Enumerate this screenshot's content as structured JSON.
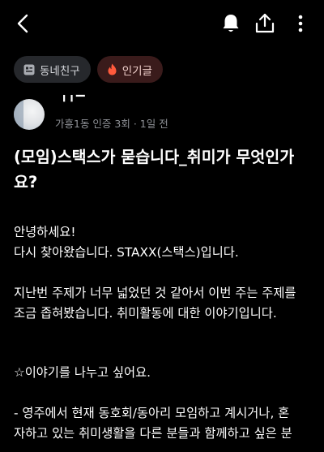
{
  "header": {
    "back_icon": "chevron-left-icon",
    "bell_icon": "bell-icon",
    "share_icon": "share-icon",
    "more_icon": "more-vertical-icon"
  },
  "chips": [
    {
      "label": "동네친구",
      "icon": "community-icon"
    },
    {
      "label": "인기글",
      "icon": "fire-icon",
      "accent": "#ff5a3c"
    }
  ],
  "author": {
    "name": "╹╹▔",
    "meta": "가흥1동 인증 3회 · 1일 전"
  },
  "post": {
    "title": "(모임)스택스가 묻습니다_취미가 무엇인가요?",
    "body": [
      "안녕하세요!",
      "다시 찾아왔습니다. STAXX(스택스)입니다.",
      "지난번 주제가 너무 넓었던 것 같아서 이번 주는 주제를",
      "조금 좁혀봤습니다. 취미활동에 대한 이야기입니다.",
      "☆이야기를 나누고 싶어요.",
      "- 영주에서 현재 동호회/동아리 모임하고 계시거나, 혼",
      "자하고 있는 취미생활을 다른 분들과 함께하고 싶은 분"
    ]
  }
}
